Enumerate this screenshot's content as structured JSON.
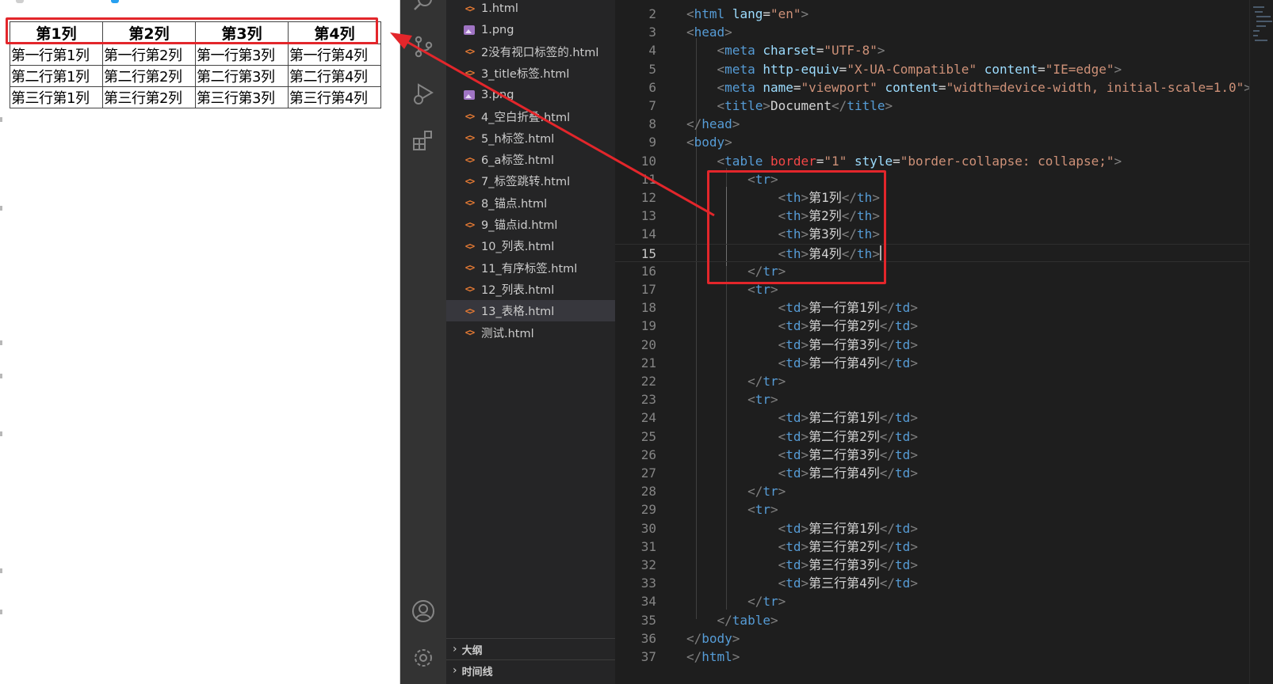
{
  "preview": {
    "table_headers": [
      "第1列",
      "第2列",
      "第3列",
      "第4列"
    ],
    "table_rows": [
      [
        "第一行第1列",
        "第一行第2列",
        "第一行第3列",
        "第一行第4列"
      ],
      [
        "第二行第1列",
        "第二行第2列",
        "第二行第3列",
        "第二行第4列"
      ],
      [
        "第三行第1列",
        "第三行第2列",
        "第三行第3列",
        "第三行第4列"
      ]
    ]
  },
  "activity_bar": {
    "icons": [
      "search-icon",
      "source-control-icon",
      "run-debug-icon",
      "extensions-icon",
      "account-icon",
      "settings-icon"
    ]
  },
  "explorer": {
    "files": [
      {
        "name": "1.html",
        "type": "html"
      },
      {
        "name": "1.png",
        "type": "png"
      },
      {
        "name": "2没有视口标签的.html",
        "type": "html"
      },
      {
        "name": "3_title标签.html",
        "type": "html"
      },
      {
        "name": "3.png",
        "type": "png"
      },
      {
        "name": "4_空白折叠.html",
        "type": "html"
      },
      {
        "name": "5_h标签.html",
        "type": "html"
      },
      {
        "name": "6_a标签.html",
        "type": "html"
      },
      {
        "name": "7_标签跳转.html",
        "type": "html"
      },
      {
        "name": "8_锚点.html",
        "type": "html"
      },
      {
        "name": "9_锚点id.html",
        "type": "html"
      },
      {
        "name": "10_列表.html",
        "type": "html"
      },
      {
        "name": "11_有序标签.html",
        "type": "html"
      },
      {
        "name": "12_列表.html",
        "type": "html"
      },
      {
        "name": "13_表格.html",
        "type": "html",
        "active": true
      },
      {
        "name": "测试.html",
        "type": "html"
      }
    ],
    "sections": [
      "大纲",
      "时间线"
    ]
  },
  "editor": {
    "current_line": 15,
    "lines": [
      {
        "n": "2",
        "text": "<html lang=\"en\">"
      },
      {
        "n": "3",
        "text": "<head>"
      },
      {
        "n": "4",
        "text": "    <meta charset=\"UTF-8\">"
      },
      {
        "n": "5",
        "text": "    <meta http-equiv=\"X-UA-Compatible\" content=\"IE=edge\">"
      },
      {
        "n": "6",
        "text": "    <meta name=\"viewport\" content=\"width=device-width, initial-scale=1.0\">"
      },
      {
        "n": "7",
        "text": "    <title>Document</title>"
      },
      {
        "n": "8",
        "text": "</head>"
      },
      {
        "n": "9",
        "text": "<body>"
      },
      {
        "n": "10",
        "text": "    <table border=\"1\" style=\"border-collapse: collapse;\">"
      },
      {
        "n": "11",
        "text": "        <tr>"
      },
      {
        "n": "12",
        "text": "            <th>第1列</th>"
      },
      {
        "n": "13",
        "text": "            <th>第2列</th>"
      },
      {
        "n": "14",
        "text": "            <th>第3列</th>"
      },
      {
        "n": "15",
        "text": "            <th>第4列</th>"
      },
      {
        "n": "16",
        "text": "        </tr>"
      },
      {
        "n": "17",
        "text": "        <tr>"
      },
      {
        "n": "18",
        "text": "            <td>第一行第1列</td>"
      },
      {
        "n": "19",
        "text": "            <td>第一行第2列</td>"
      },
      {
        "n": "20",
        "text": "            <td>第一行第3列</td>"
      },
      {
        "n": "21",
        "text": "            <td>第一行第4列</td>"
      },
      {
        "n": "22",
        "text": "        </tr>"
      },
      {
        "n": "23",
        "text": "        <tr>"
      },
      {
        "n": "24",
        "text": "            <td>第二行第1列</td>"
      },
      {
        "n": "25",
        "text": "            <td>第二行第2列</td>"
      },
      {
        "n": "26",
        "text": "            <td>第二行第3列</td>"
      },
      {
        "n": "27",
        "text": "            <td>第二行第4列</td>"
      },
      {
        "n": "28",
        "text": "        </tr>"
      },
      {
        "n": "29",
        "text": "        <tr>"
      },
      {
        "n": "30",
        "text": "            <td>第三行第1列</td>"
      },
      {
        "n": "31",
        "text": "            <td>第三行第2列</td>"
      },
      {
        "n": "32",
        "text": "            <td>第三行第3列</td>"
      },
      {
        "n": "33",
        "text": "            <td>第三行第4列</td>"
      },
      {
        "n": "34",
        "text": "        </tr>"
      },
      {
        "n": "35",
        "text": "    </table>"
      },
      {
        "n": "36",
        "text": "</body>"
      },
      {
        "n": "37",
        "text": "</html>"
      }
    ]
  },
  "colors": {
    "annotation": "#e3262b",
    "html_icon": "#e37933",
    "png_icon": "#a074c4",
    "tag": "#569cd6",
    "attribute": "#9cdcfe",
    "string": "#ce9178"
  }
}
